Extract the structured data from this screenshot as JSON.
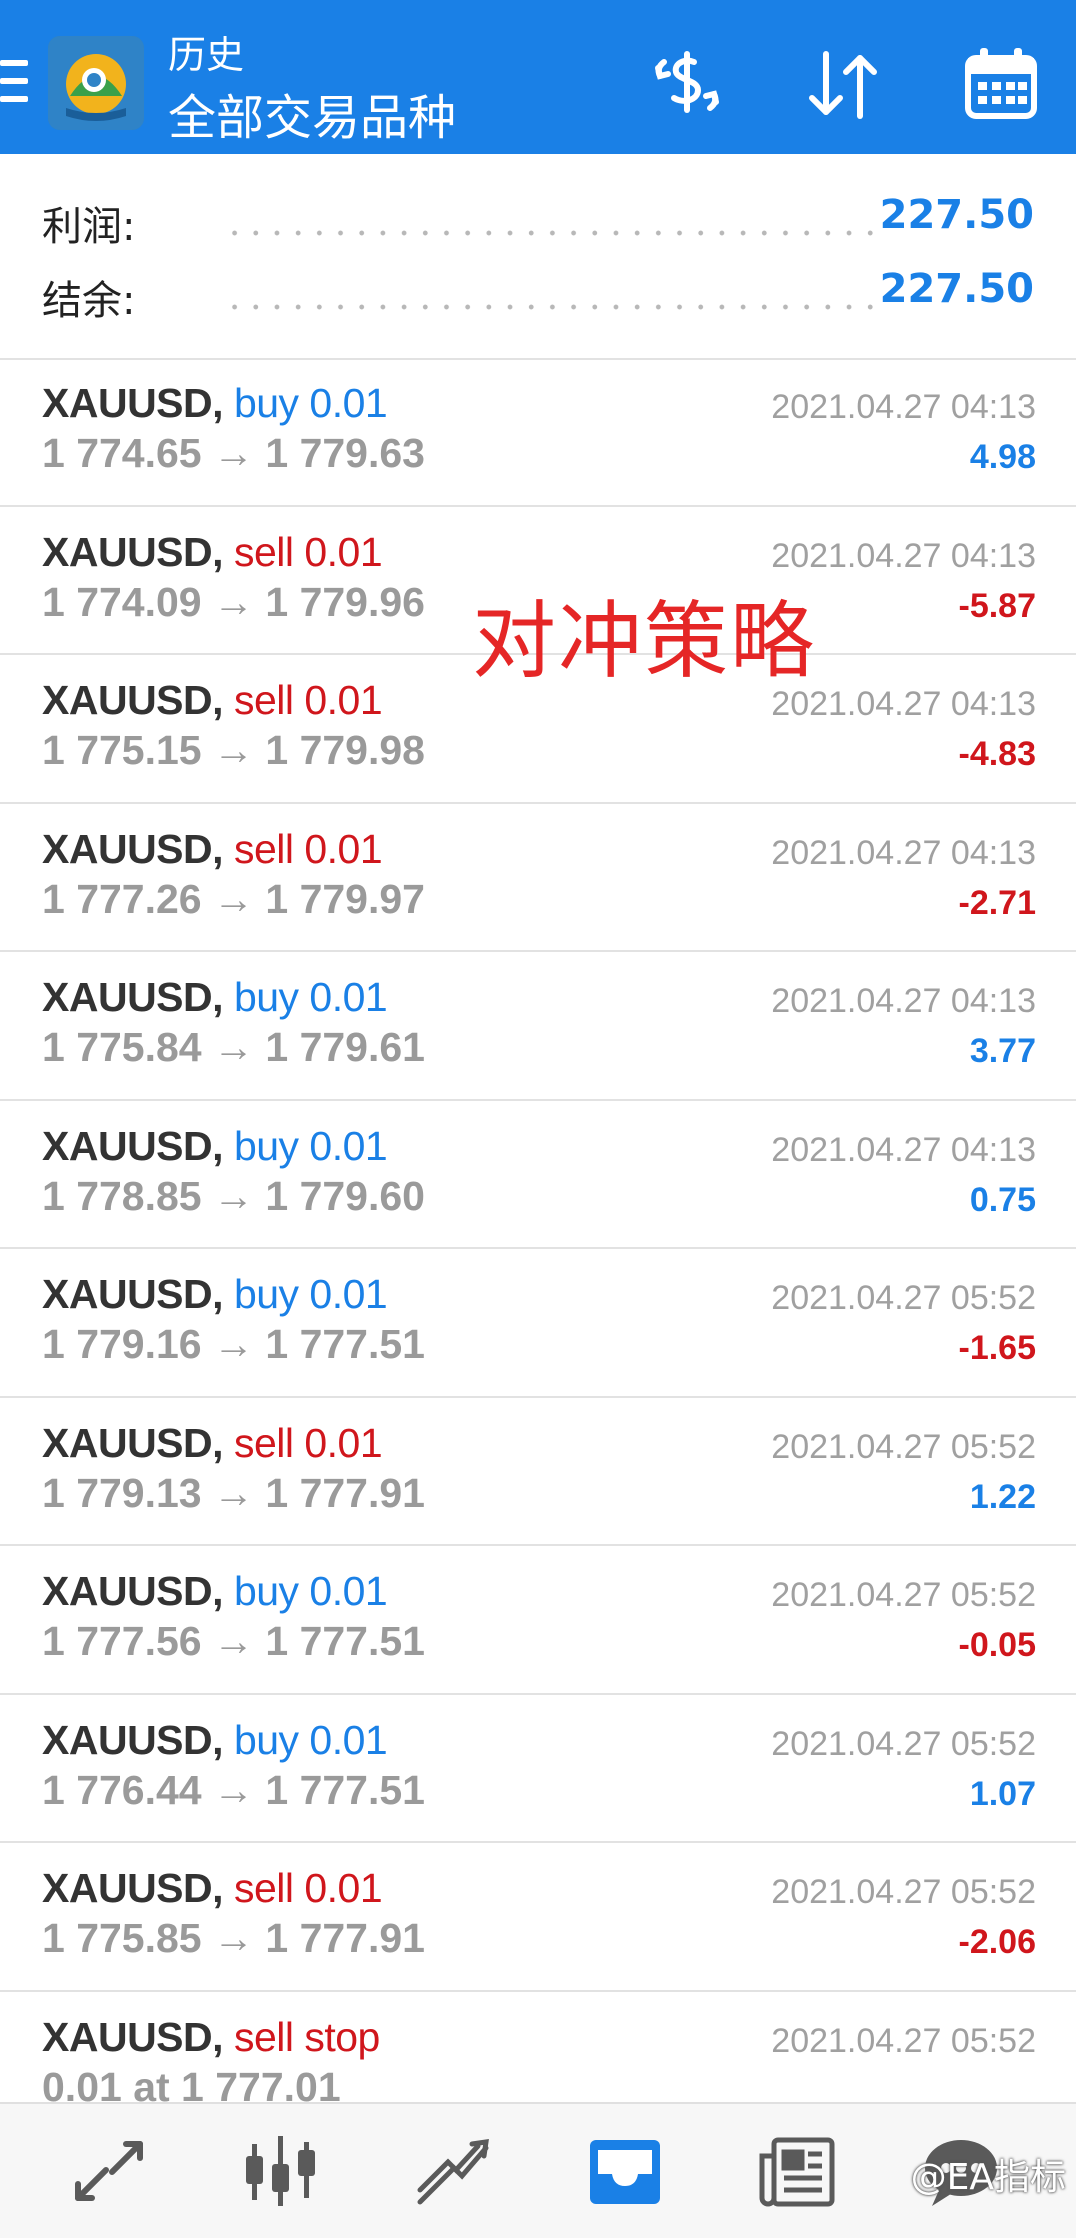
{
  "header": {
    "title_small": "历史",
    "title_big": "全部交易品种",
    "accent_color": "#1A80E6",
    "icons": [
      "menu-icon",
      "app-logo-icon",
      "deposit-withdraw-icon",
      "sort-icon",
      "calendar-icon"
    ]
  },
  "summary": {
    "profit_label": "利润:",
    "profit_value": "227.50",
    "balance_label": "结余:",
    "balance_value": "227.50"
  },
  "deals": [
    {
      "symbol": "XAUUSD,",
      "type": "buy 0.01",
      "side": "buy",
      "prices": "1 774.65 → 1 779.63",
      "time": "2021.04.27 04:13",
      "profit": "4.98",
      "sign": "pos"
    },
    {
      "symbol": "XAUUSD,",
      "type": "sell 0.01",
      "side": "sell",
      "prices": "1 774.09 → 1 779.96",
      "time": "2021.04.27 04:13",
      "profit": "-5.87",
      "sign": "neg"
    },
    {
      "symbol": "XAUUSD,",
      "type": "sell 0.01",
      "side": "sell",
      "prices": "1 775.15 → 1 779.98",
      "time": "2021.04.27 04:13",
      "profit": "-4.83",
      "sign": "neg"
    },
    {
      "symbol": "XAUUSD,",
      "type": "sell 0.01",
      "side": "sell",
      "prices": "1 777.26 → 1 779.97",
      "time": "2021.04.27 04:13",
      "profit": "-2.71",
      "sign": "neg"
    },
    {
      "symbol": "XAUUSD,",
      "type": "buy 0.01",
      "side": "buy",
      "prices": "1 775.84 → 1 779.61",
      "time": "2021.04.27 04:13",
      "profit": "3.77",
      "sign": "pos"
    },
    {
      "symbol": "XAUUSD,",
      "type": "buy 0.01",
      "side": "buy",
      "prices": "1 778.85 → 1 779.60",
      "time": "2021.04.27 04:13",
      "profit": "0.75",
      "sign": "pos"
    },
    {
      "symbol": "XAUUSD,",
      "type": "buy 0.01",
      "side": "buy",
      "prices": "1 779.16 → 1 777.51",
      "time": "2021.04.27 05:52",
      "profit": "-1.65",
      "sign": "neg"
    },
    {
      "symbol": "XAUUSD,",
      "type": "sell 0.01",
      "side": "sell",
      "prices": "1 779.13 → 1 777.91",
      "time": "2021.04.27 05:52",
      "profit": "1.22",
      "sign": "pos"
    },
    {
      "symbol": "XAUUSD,",
      "type": "buy 0.01",
      "side": "buy",
      "prices": "1 777.56 → 1 777.51",
      "time": "2021.04.27 05:52",
      "profit": "-0.05",
      "sign": "neg"
    },
    {
      "symbol": "XAUUSD,",
      "type": "buy 0.01",
      "side": "buy",
      "prices": "1 776.44 → 1 777.51",
      "time": "2021.04.27 05:52",
      "profit": "1.07",
      "sign": "pos"
    },
    {
      "symbol": "XAUUSD,",
      "type": "sell 0.01",
      "side": "sell",
      "prices": "1 775.85 → 1 777.91",
      "time": "2021.04.27 05:52",
      "profit": "-2.06",
      "sign": "neg"
    },
    {
      "symbol": "XAUUSD,",
      "type": "sell stop",
      "side": "sell",
      "prices": "0.01 at 1 777.01",
      "time": "2021.04.27 05:52",
      "profit": "",
      "sign": "none"
    }
  ],
  "overlay_text": "对冲策略",
  "bottom_nav": {
    "items": [
      "quotes-icon",
      "chart-icon",
      "trade-icon",
      "history-icon",
      "news-icon",
      "chat-icon"
    ],
    "active": "history-icon"
  },
  "watermark": "@EA指标",
  "colors": {
    "buy": "#1A80E6",
    "sell": "#D0161C",
    "overlay": "#E52626"
  }
}
